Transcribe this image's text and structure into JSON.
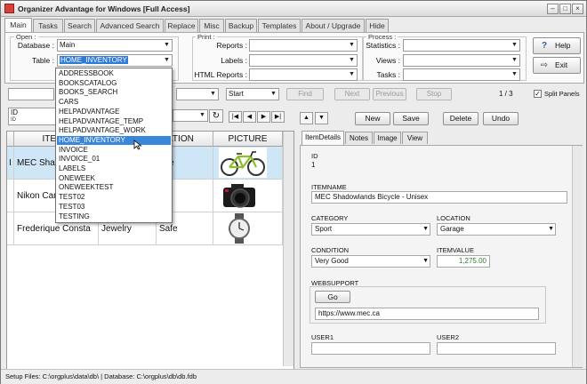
{
  "window": {
    "title": "Organizer Advantage for Windows [Full Access]"
  },
  "tabs": [
    "Main",
    "Tasks",
    "Search",
    "Advanced Search",
    "Replace",
    "Misc",
    "Backup",
    "Templates",
    "About / Upgrade",
    "Hide"
  ],
  "open_group": {
    "title": "Open :",
    "database_label": "Database :",
    "database_value": "Main",
    "table_label": "Table :",
    "table_value": "HOME_INVENTORY"
  },
  "print_group": {
    "title": "Print :",
    "reports_label": "Reports :",
    "labels_label": "Labels :",
    "html_reports_label": "HTML Reports :"
  },
  "process_group": {
    "title": "Process :",
    "statistics_label": "Statistics :",
    "views_label": "Views :",
    "tasks_label": "Tasks :"
  },
  "buttons": {
    "help": "Help",
    "exit": "Exit"
  },
  "search_bar": {
    "start_value": "Start",
    "find": "Find",
    "next": "Next",
    "previous": "Previous",
    "stop": "Stop",
    "record_count": "1 / 3",
    "split_panels": "Split Panels"
  },
  "left_panel": {
    "field_value": "ID",
    "field_sub": "ID"
  },
  "table_dropdown": {
    "options": [
      "ADDRESSBOOK",
      "BOOKSCATALOG",
      "BOOKS_SEARCH",
      "CARS",
      "HELPADVANTAGE",
      "HELPADVANTAGE_TEMP",
      "HELPADVANTAGE_WORK",
      "HOME_INVENTORY",
      "INVOICE",
      "INVOICE_01",
      "LABELS",
      "ONEWEEK",
      "ONEWEEKTEST",
      "TEST02",
      "TEST03",
      "TESTING"
    ],
    "selected": "HOME_INVENTORY"
  },
  "grid": {
    "columns": [
      "ITEMN",
      "ATION",
      "PICTURE"
    ],
    "rows": [
      {
        "marker": "I",
        "itemname": "MEC Shad",
        "category": "",
        "location": "age"
      },
      {
        "marker": "",
        "itemname": "Nikon Car",
        "category": "",
        "location": "e"
      },
      {
        "marker": "",
        "itemname": "Frederique Consta",
        "category": "Jewelry",
        "location": "Safe"
      }
    ]
  },
  "record_buttons": {
    "new": "New",
    "save": "Save",
    "delete": "Delete",
    "undo": "Undo"
  },
  "record_tabs": [
    "ItemDetails",
    "Notes",
    "Image",
    "View"
  ],
  "details": {
    "id_label": "ID",
    "id_value": "1",
    "itemname_label": "ITEMNAME",
    "itemname_value": "MEC Shadowlands Bicycle - Unisex",
    "category_label": "CATEGORY",
    "category_value": "Sport",
    "location_label": "LOCATION",
    "location_value": "Garage",
    "condition_label": "CONDITION",
    "condition_value": "Very Good",
    "itemvalue_label": "ITEMVALUE",
    "itemvalue_value": "1,275.00",
    "websupport_label": "WEBSUPPORT",
    "go_button": "Go",
    "websupport_value": "https://www.mec.ca",
    "user1_label": "USER1",
    "user2_label": "USER2"
  },
  "status_bar": {
    "text": "Setup Files: C:\\orgplus\\data\\db\\ | Database: C:\\orgplus\\db\\db.fdb"
  }
}
